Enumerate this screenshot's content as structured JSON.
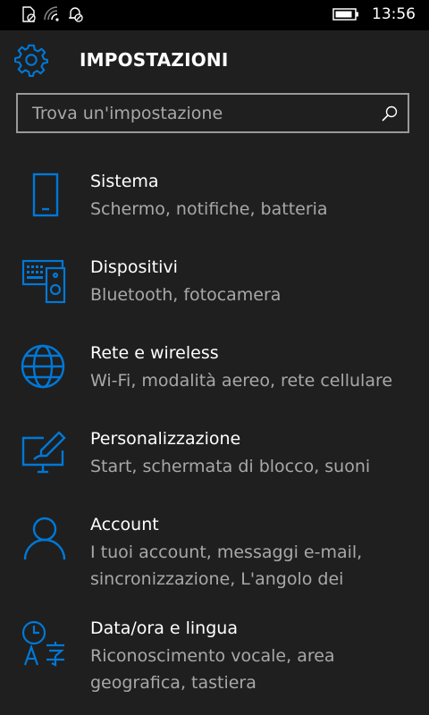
{
  "status_bar": {
    "time": "13:56",
    "icons": [
      "no-sim-icon",
      "wifi-off-icon",
      "notifications-off-icon",
      "battery-icon"
    ]
  },
  "header": {
    "icon": "gear-icon",
    "title": "IMPOSTAZIONI"
  },
  "search": {
    "placeholder": "Trova un'impostazione",
    "value": "",
    "icon": "search-icon"
  },
  "accent_color": "#0078d7",
  "settings": [
    {
      "icon": "phone-icon",
      "title": "Sistema",
      "description": "Schermo, notifiche, batteria"
    },
    {
      "icon": "devices-icon",
      "title": "Dispositivi",
      "description": "Bluetooth, fotocamera"
    },
    {
      "icon": "globe-icon",
      "title": "Rete e wireless",
      "description": "Wi-Fi, modalità aereo, rete cellulare"
    },
    {
      "icon": "personalization-icon",
      "title": "Personalizzazione",
      "description": "Start, schermata di blocco, suoni"
    },
    {
      "icon": "account-icon",
      "title": "Account",
      "description": "I tuoi account, messaggi e-mail, sincronizzazione, L'angolo dei"
    },
    {
      "icon": "time-language-icon",
      "title": "Data/ora e lingua",
      "description": "Riconoscimento vocale, area geografica, tastiera"
    }
  ]
}
